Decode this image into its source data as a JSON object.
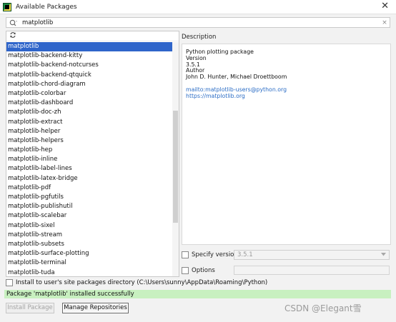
{
  "window": {
    "title": "Available Packages",
    "close_symbol": "✕"
  },
  "search": {
    "value": "matplotlib",
    "clear_symbol": "×"
  },
  "packages": [
    "matplotlib",
    "matplotlib-backend-kitty",
    "matplotlib-backend-notcurses",
    "matplotlib-backend-qtquick",
    "matplotlib-chord-diagram",
    "matplotlib-colorbar",
    "matplotlib-dashboard",
    "matplotlib-doc-zh",
    "matplotlib-extract",
    "matplotlib-helper",
    "matplotlib-helpers",
    "matplotlib-hep",
    "matplotlib-inline",
    "matplotlib-label-lines",
    "matplotlib-latex-bridge",
    "matplotlib-pdf",
    "matplotlib-pgfutils",
    "matplotlib-publishutil",
    "matplotlib-scalebar",
    "matplotlib-sixel",
    "matplotlib-stream",
    "matplotlib-subsets",
    "matplotlib-surface-plotting",
    "matplotlib-terminal",
    "matplotlib-tuda"
  ],
  "selected_index": 0,
  "description": {
    "header": "Description",
    "summary": "Python plotting package",
    "version_label": "Version",
    "version": "3.5.1",
    "author_label": "Author",
    "author": "John D. Hunter, Michael Droettboom",
    "email_link": "mailto:matplotlib-users@python.org",
    "url_link": "https://matplotlib.org"
  },
  "options": {
    "specify_version_label": "Specify version",
    "specify_version_value": "3.5.1",
    "options_label": "Options",
    "options_value": ""
  },
  "install_user_site_label": "Install to user's site packages directory (C:\\Users\\sunny\\AppData\\Roaming\\Python)",
  "status_message": "Package 'matplotlib' installed successfully",
  "buttons": {
    "install": "Install Package",
    "manage": "Manage Repositories"
  },
  "watermark": "CSDN @Elegant雪",
  "icons": {
    "app": "pycharm-icon",
    "search": "search-icon",
    "refresh": "refresh-icon"
  },
  "colors": {
    "selection": "#2f65ca",
    "status_bg": "#c8f0c0",
    "link": "#2a6cc5"
  }
}
